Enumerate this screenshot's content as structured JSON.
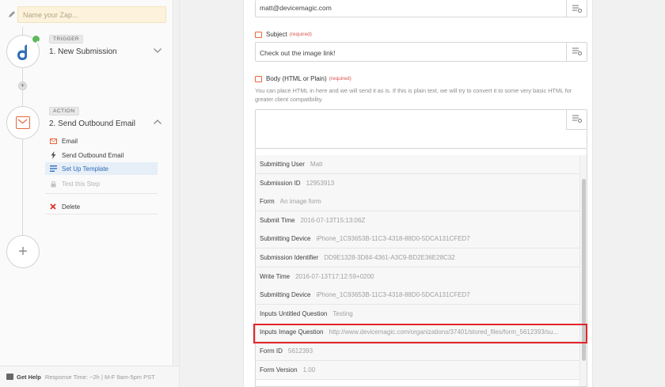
{
  "sidebar": {
    "zap_name_placeholder": "Name your Zap...",
    "trigger": {
      "badge": "TRIGGER",
      "title": "1. New Submission"
    },
    "action": {
      "badge": "ACTION",
      "title": "2. Send Outbound Email"
    },
    "action_items": [
      {
        "label": "Email"
      },
      {
        "label": "Send Outbound Email"
      },
      {
        "label": "Set Up Template"
      },
      {
        "label": "Test this Step"
      },
      {
        "label": "Delete"
      }
    ],
    "help": {
      "label": "Get Help",
      "response": "Response Time: ~2h",
      "hours": "| M-F 9am-5pm PST"
    }
  },
  "form": {
    "to_value": "matt@devicemagic.com",
    "subject": {
      "label": "Subject",
      "required": "(required)",
      "value": "Check out the image link!"
    },
    "body": {
      "label": "Body (HTML or Plain)",
      "required": "(required)",
      "help": "You can place HTML in here and we will send it as is. If this is plain text, we will try to convert it to some very basic HTML for greater client compatibility.",
      "value": ""
    }
  },
  "dropdown_rows": [
    {
      "key": "Submitting User",
      "value": "Matt"
    },
    {
      "key": "Submission ID",
      "value": "12953913"
    },
    {
      "key": "Form",
      "value": "An image form"
    },
    {
      "key": "Submit Time",
      "value": "2016-07-13T15:13:06Z"
    },
    {
      "key": "Submitting Device",
      "value": "iPhone_1C93653B-11C3-4318-88D0-5DCA131CFED7"
    },
    {
      "key": "Submission Identifier",
      "value": "DD9E1328-3D84-4361-A3C9-BD2E36E28C32"
    },
    {
      "key": "Write Time",
      "value": "2016-07-13T17:12:59+0200"
    },
    {
      "key": "Submitting Device",
      "value": "iPhone_1C93653B-11C3-4318-88D0-5DCA131CFED7"
    },
    {
      "key": "Inputs Untitled Question",
      "value": "Testing"
    },
    {
      "key": "Inputs Image Question",
      "value": "http://www.devicemagic.com/organizations/37401/stored_files/form_5612393/su..."
    },
    {
      "key": "Form ID",
      "value": "5612393"
    },
    {
      "key": "Form Version",
      "value": "1.00"
    }
  ],
  "colors": {
    "accent": "#2f6db5",
    "trigger_check": "#5cb85c",
    "action_icon": "#e8673e",
    "highlight": "#e3262b",
    "zap_name_bg": "#fdf3dc"
  }
}
